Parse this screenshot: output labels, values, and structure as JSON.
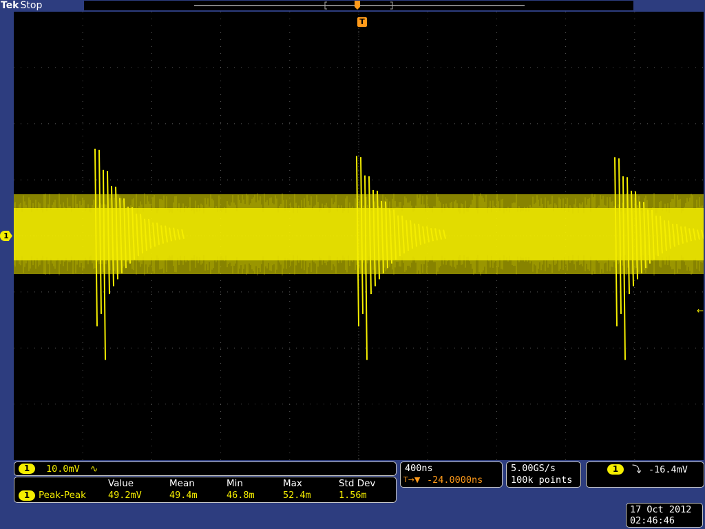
{
  "header": {
    "brand": "Tek",
    "status": "Stop"
  },
  "markers": {
    "trigger_pos": "T",
    "channel_marker": "1",
    "trigger_level_marker": "←"
  },
  "channel": {
    "number": "1",
    "scale": "10.0mV",
    "coupling_icon": "∿"
  },
  "measurement": {
    "headers": [
      "Value",
      "Mean",
      "Min",
      "Max",
      "Std Dev"
    ],
    "channel": "1",
    "name": "Peak-Peak",
    "values": [
      "49.2mV",
      "49.4m",
      "46.8m",
      "52.4m",
      "1.56m"
    ]
  },
  "timebase": {
    "scale": "400ns",
    "delay_icon": "T→▼",
    "delay": "-24.0000ns"
  },
  "acquisition": {
    "sample_rate": "5.00GS/s",
    "record_length": "100k points"
  },
  "trigger": {
    "channel": "1",
    "slope_icon": "falling-edge-icon",
    "slope_glyph": "⤵",
    "level": "-16.4mV"
  },
  "datetime": {
    "date": "17 Oct  2012",
    "time": "02:46:46"
  },
  "colors": {
    "trace": "#f5ee00",
    "frame": "#2d3d7f",
    "trigger": "#ff9a1a",
    "grid": "#5a5a5a"
  }
}
